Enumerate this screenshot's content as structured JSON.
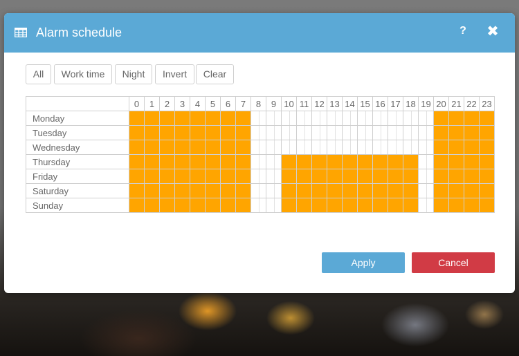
{
  "dialog": {
    "title": "Alarm schedule",
    "help_icon": "question-mark-icon",
    "close_icon": "close-icon",
    "header_icon": "table-grid-icon",
    "header_color": "#5ba9d6"
  },
  "presets": {
    "all": "All",
    "work_time": "Work time",
    "night": "Night",
    "invert": "Invert",
    "clear": "Clear"
  },
  "schedule": {
    "hours": [
      "0",
      "1",
      "2",
      "3",
      "4",
      "5",
      "6",
      "7",
      "8",
      "9",
      "10",
      "11",
      "12",
      "13",
      "14",
      "15",
      "16",
      "17",
      "18",
      "19",
      "20",
      "21",
      "22",
      "23"
    ],
    "active_color": "#ffa500",
    "days": [
      {
        "name": "Monday",
        "active_hours": [
          0,
          1,
          2,
          3,
          4,
          5,
          6,
          7,
          20,
          21,
          22,
          23
        ]
      },
      {
        "name": "Tuesday",
        "active_hours": [
          0,
          1,
          2,
          3,
          4,
          5,
          6,
          7,
          20,
          21,
          22,
          23
        ]
      },
      {
        "name": "Wednesday",
        "active_hours": [
          0,
          1,
          2,
          3,
          4,
          5,
          6,
          7,
          20,
          21,
          22,
          23
        ]
      },
      {
        "name": "Thursday",
        "active_hours": [
          0,
          1,
          2,
          3,
          4,
          5,
          6,
          7,
          10,
          11,
          12,
          13,
          14,
          15,
          16,
          17,
          18,
          20,
          21,
          22,
          23
        ]
      },
      {
        "name": "Friday",
        "active_hours": [
          0,
          1,
          2,
          3,
          4,
          5,
          6,
          7,
          10,
          11,
          12,
          13,
          14,
          15,
          16,
          17,
          18,
          20,
          21,
          22,
          23
        ]
      },
      {
        "name": "Saturday",
        "active_hours": [
          0,
          1,
          2,
          3,
          4,
          5,
          6,
          7,
          10,
          11,
          12,
          13,
          14,
          15,
          16,
          17,
          18,
          20,
          21,
          22,
          23
        ]
      },
      {
        "name": "Sunday",
        "active_hours": [
          0,
          1,
          2,
          3,
          4,
          5,
          6,
          7,
          10,
          11,
          12,
          13,
          14,
          15,
          16,
          17,
          18,
          20,
          21,
          22,
          23
        ]
      }
    ]
  },
  "footer": {
    "apply": "Apply",
    "cancel": "Cancel",
    "apply_color": "#5ba9d6",
    "cancel_color": "#d13b45"
  }
}
